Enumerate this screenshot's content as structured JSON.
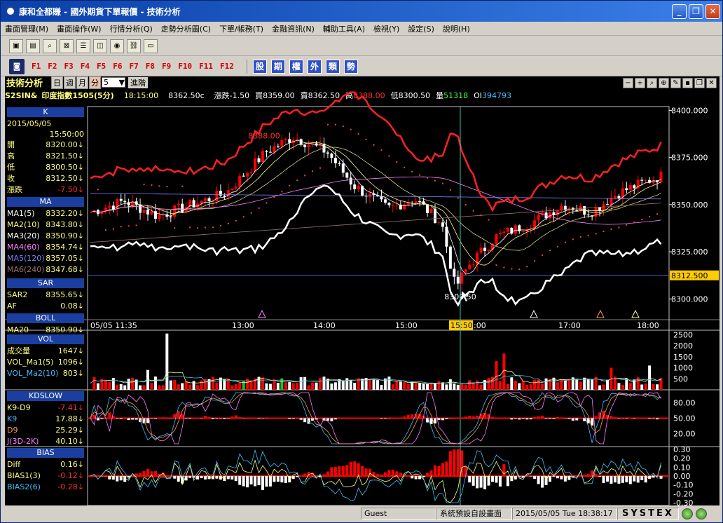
{
  "window": {
    "title": "康和全都賺 - 國外期貨下單報價 - 技術分析",
    "minimize": "_",
    "maximize": "❐",
    "close": "✕"
  },
  "menu": [
    "畫面管理(M)",
    "畫面操作(W)",
    "行情分析(Q)",
    "走勢分析圖(C)",
    "下單/帳務(T)",
    "金融資訊(N)",
    "輔助工具(A)",
    "檢視(Y)",
    "設定(S)",
    "說明(H)"
  ],
  "fkeys": [
    "F1",
    "F2",
    "F3",
    "F4",
    "F5",
    "F6",
    "F7",
    "F8",
    "F9",
    "F10",
    "F11",
    "F12"
  ],
  "categories": [
    "股",
    "期",
    "權",
    "外",
    "類",
    "勢"
  ],
  "header": {
    "title": "技術分析",
    "periods": [
      "日",
      "週",
      "月",
      "分"
    ],
    "selected_period": "分",
    "period_value": "5",
    "advanced": "進階"
  },
  "quote": {
    "symbol": "S2SIN&",
    "name": "印度指數1505(5分)",
    "time": "18:15:00",
    "last": "8362.50c",
    "change": "漲跌-1.50",
    "bid": "買8359.00",
    "ask": "賣8362.50",
    "high_label": "高",
    "high": "8388.00",
    "low": "低8300.50",
    "volume_label": "量",
    "volume": "51318",
    "oi_label": "OI",
    "oi": "394793"
  },
  "panel": {
    "k": {
      "title": "K",
      "date": "2015/05/05",
      "time": "15:50:00",
      "rows": [
        {
          "label": "開",
          "value": "8320.00"
        },
        {
          "label": "高",
          "value": "8321.50"
        },
        {
          "label": "低",
          "value": "8300.50"
        },
        {
          "label": "收",
          "value": "8312.50"
        },
        {
          "label": "漲跌",
          "value": "-7.50"
        }
      ]
    },
    "ma": {
      "title": "MA",
      "rows": [
        {
          "label": "MA1(5)",
          "value": "8332.20",
          "color": "#ffffff"
        },
        {
          "label": "MA2(10)",
          "value": "8343.80",
          "color": "#ffff80"
        },
        {
          "label": "MA3(20)",
          "value": "8350.90",
          "color": "#ffffff"
        },
        {
          "label": "MA4(60)",
          "value": "8354.74",
          "color": "#ff80ff"
        },
        {
          "label": "MA5(120)",
          "value": "8357.05",
          "color": "#8080ff"
        },
        {
          "label": "MA6(240)",
          "value": "8347.68",
          "color": "#a07070"
        }
      ]
    },
    "sar": {
      "title": "SAR",
      "rows": [
        {
          "label": "SAR2",
          "value": "8355.65"
        },
        {
          "label": "AF",
          "value": "0.08"
        }
      ]
    },
    "boll": {
      "title": "BOLL",
      "rows": [
        {
          "label": "MA20",
          "value": "8350.90"
        }
      ]
    },
    "vol": {
      "title": "VOL",
      "rows": [
        {
          "label": "成交量",
          "value": "1647"
        },
        {
          "label": "VOL_Ma1(5)",
          "value": "1096"
        },
        {
          "label": "VOL_Ma2(10)",
          "value": "803"
        }
      ]
    },
    "kd": {
      "title": "KDSLOW",
      "rows": [
        {
          "label": "K9-D9",
          "value": "-7.41"
        },
        {
          "label": "K9",
          "value": "17.88"
        },
        {
          "label": "D9",
          "value": "25.29"
        },
        {
          "label": "J(3D-2K)",
          "value": "40.10"
        }
      ]
    },
    "bias": {
      "title": "BIAS",
      "rows": [
        {
          "label": "Diff",
          "value": "0.16"
        },
        {
          "label": "BIAS1(3)",
          "value": "-0.12"
        },
        {
          "label": "BIAS2(6)",
          "value": "-0.28"
        }
      ]
    }
  },
  "axes": {
    "price_ticks": [
      "8400.000",
      "8375.000",
      "8350.000",
      "8325.000",
      "8300.000"
    ],
    "price_current": "8312.500",
    "high_marker": "8388.00",
    "low_marker": "8300.50",
    "time_labels": [
      "05/05 11:35",
      "13:00",
      "14:00",
      "15:00",
      "15:50",
      "17:00",
      "18:00"
    ],
    "cursor_time": "15:50",
    "cursor_suffix": ":00",
    "vol_ticks": [
      "2500",
      "2000",
      "1500",
      "1000",
      "500"
    ],
    "kd_ticks": [
      "80.00",
      "50.00",
      "20.00"
    ],
    "bias_ticks": [
      "0.30",
      "0.20",
      "0.10",
      "0.00",
      "-0.10",
      "-0.20",
      "-0.30"
    ]
  },
  "status": {
    "user": "Guest",
    "screen": "系統預設自設畫面",
    "datetime": "2015/05/05 Tue 18:38:17",
    "brand": "SYSTEX"
  },
  "colors": {
    "up": "#ff0000",
    "down": "#ffffff",
    "upper_band": "#ff2020",
    "lower_band": "#ffffff",
    "sar": "#ff4040",
    "cursor": "#40c0c0"
  }
}
